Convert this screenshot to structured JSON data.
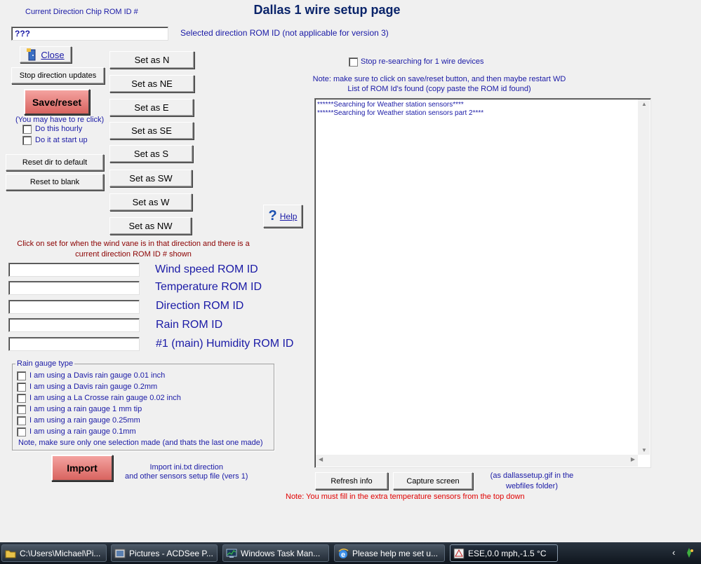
{
  "window": {
    "title": "Dallas 1 wire setup page",
    "current_dir_label": "Current Direction Chip ROM ID #",
    "current_dir_value": "???",
    "selected_dir_label": "Selected direction ROM ID  (not applicable for version 3)"
  },
  "buttons": {
    "close": "Close",
    "stop_updates": "Stop direction updates",
    "save_reset": "Save/reset",
    "reclick_note": "(You may have to re click)",
    "reset_default": "Reset dir to default",
    "reset_blank": "Reset to blank",
    "help": "Help",
    "import": "Import",
    "refresh": "Refresh info",
    "capture": "Capture screen"
  },
  "checkboxes": {
    "hourly": "Do this hourly",
    "startup": "Do it at start up",
    "stop_research": "Stop re-searching for 1 wire devices"
  },
  "set_buttons": [
    "Set as  N",
    "Set as NE",
    "Set as E",
    "Set as SE",
    "Set as S",
    "Set as SW",
    "Set as W",
    "Set as NW"
  ],
  "click_note": [
    "Click on set for when the wind vane is in that direction and there is a",
    "current direction ROM ID #  shown"
  ],
  "rom_fields": [
    {
      "label": "Wind speed ROM ID",
      "value": ""
    },
    {
      "label": "Temperature ROM ID",
      "value": ""
    },
    {
      "label": "Direction ROM ID",
      "value": ""
    },
    {
      "label": "Rain ROM ID",
      "value": ""
    },
    {
      "label": "#1 (main) Humidity ROM ID",
      "value": ""
    }
  ],
  "rain_gauge": {
    "title": "Rain gauge type",
    "options": [
      "I am using a Davis rain gauge 0.01 inch",
      "I am using a Davis rain gauge 0.2mm",
      "I am using a La Crosse rain gauge 0.02 inch",
      "I am using a rain gauge 1 mm tip",
      "I am using a rain gauge 0.25mm",
      "I am using a rain gauge 0.1mm"
    ],
    "note": "Note, make sure only one selection made (and thats the last one made)"
  },
  "import_note": [
    "Import ini.txt direction",
    "and other sensors setup file (vers 1)"
  ],
  "right_notes": [
    "Note: make sure to click on save/reset button, and then maybe restart WD",
    "List of ROM Id's found (copy paste the ROM id found)"
  ],
  "rom_list": [
    "******Searching for Weather station sensors****",
    "******Searching for Weather station sensors part 2****"
  ],
  "capture_note": [
    "(as dallassetup.gif in the",
    "webfiles folder)"
  ],
  "bottom_note": "Note: You must fill in the extra temperature sensors from the top down",
  "taskbar": {
    "items": [
      "C:\\Users\\Michael\\Pi...",
      "Pictures - ACDSee P...",
      "Windows Task Man...",
      "Please help me set u...",
      "ESE,0.0 mph,-1.5 °C"
    ]
  },
  "icons": [
    "close-door-icon",
    "help-question-icon",
    "folder-icon",
    "acdsee-icon",
    "task-manager-icon",
    "ie-icon",
    "weather-display-icon",
    "chevron-left-icon",
    "tray-icon"
  ],
  "colors": {
    "label_blue": "#1a1aa6",
    "note_maroon": "#8b0000",
    "note_red": "#e00000",
    "save_button": "#e0736f"
  }
}
